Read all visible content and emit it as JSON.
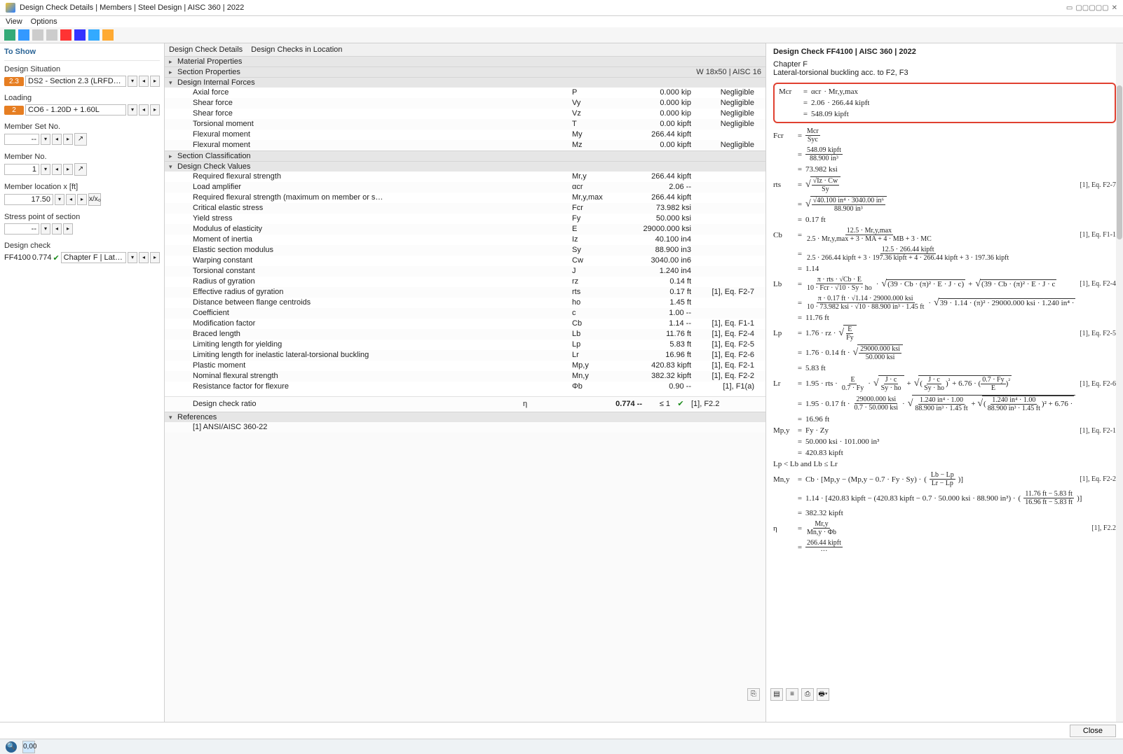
{
  "window": {
    "title": "Design Check Details | Members | Steel Design | AISC 360 | 2022",
    "menu": {
      "view": "View",
      "options": "Options"
    },
    "close": "Close"
  },
  "left": {
    "title": "To Show",
    "design_situation": {
      "label": "Design Situation",
      "badge": "2.3",
      "value": "DS2 - Section 2.3 (LRFD), 1. to 5."
    },
    "loading": {
      "label": "Loading",
      "badge": "2",
      "value": "CO6 - 1.20D + 1.60L"
    },
    "member_set": {
      "label": "Member Set No.",
      "value": "-- "
    },
    "member_no": {
      "label": "Member No.",
      "value": "1 "
    },
    "member_loc": {
      "label": "Member location x [ft]",
      "value": "17.50"
    },
    "stress_point": {
      "label": "Stress point of section",
      "value": "-- "
    },
    "design_check": {
      "label": "Design check",
      "code": "FF4100",
      "ratio": "0.774",
      "desc": "Chapter F | Lateral-torsio..."
    }
  },
  "center": {
    "tab1": "Design Check Details",
    "tab2": "Design Checks in Location",
    "sections": {
      "mat": "Material Properties",
      "sect": "Section Properties",
      "sect_extra": "W 18x50 | AISC 16",
      "forces": "Design Internal Forces",
      "classif": "Section Classification",
      "values": "Design Check Values",
      "refs": "References"
    },
    "forces": [
      {
        "name": "Axial force",
        "sym": "P",
        "val": "0.000 kip",
        "ref": "Negligible"
      },
      {
        "name": "Shear force",
        "sym": "Vy",
        "val": "0.000 kip",
        "ref": "Negligible"
      },
      {
        "name": "Shear force",
        "sym": "Vz",
        "val": "0.000 kip",
        "ref": "Negligible"
      },
      {
        "name": "Torsional moment",
        "sym": "T",
        "val": "0.00 kipft",
        "ref": "Negligible"
      },
      {
        "name": "Flexural moment",
        "sym": "My",
        "val": "266.44 kipft",
        "ref": ""
      },
      {
        "name": "Flexural moment",
        "sym": "Mz",
        "val": "0.00 kipft",
        "ref": "Negligible"
      }
    ],
    "values": [
      {
        "name": "Required flexural strength",
        "sym": "Mr,y",
        "val": "266.44 kipft",
        "ref": ""
      },
      {
        "name": "Load amplifier",
        "sym": "αcr",
        "val": "2.06 --",
        "ref": ""
      },
      {
        "name": "Required flexural strength (maximum on member or s…",
        "sym": "Mr,y,max",
        "val": "266.44 kipft",
        "ref": ""
      },
      {
        "name": "Critical elastic stress",
        "sym": "Fcr",
        "val": "73.982 ksi",
        "ref": ""
      },
      {
        "name": "Yield stress",
        "sym": "Fy",
        "val": "50.000 ksi",
        "ref": ""
      },
      {
        "name": "Modulus of elasticity",
        "sym": "E",
        "val": "29000.000 ksi",
        "ref": ""
      },
      {
        "name": "Moment of inertia",
        "sym": "Iz",
        "val": "40.100 in4",
        "ref": ""
      },
      {
        "name": "Elastic section modulus",
        "sym": "Sy",
        "val": "88.900 in3",
        "ref": ""
      },
      {
        "name": "Warping constant",
        "sym": "Cw",
        "val": "3040.00 in6",
        "ref": ""
      },
      {
        "name": "Torsional constant",
        "sym": "J",
        "val": "1.240 in4",
        "ref": ""
      },
      {
        "name": "Radius of gyration",
        "sym": "rz",
        "val": "0.14 ft",
        "ref": ""
      },
      {
        "name": "Effective radius of gyration",
        "sym": "rts",
        "val": "0.17 ft",
        "ref": "[1], Eq. F2-7"
      },
      {
        "name": "Distance between flange centroids",
        "sym": "ho",
        "val": "1.45 ft",
        "ref": ""
      },
      {
        "name": "Coefficient",
        "sym": "c",
        "val": "1.00 --",
        "ref": ""
      },
      {
        "name": "Modification factor",
        "sym": "Cb",
        "val": "1.14 --",
        "ref": "[1], Eq. F1-1"
      },
      {
        "name": "Braced length",
        "sym": "Lb",
        "val": "11.76 ft",
        "ref": "[1], Eq. F2-4"
      },
      {
        "name": "Limiting length for yielding",
        "sym": "Lp",
        "val": "5.83 ft",
        "ref": "[1], Eq. F2-5"
      },
      {
        "name": "Limiting length for inelastic lateral-torsional buckling",
        "sym": "Lr",
        "val": "16.96 ft",
        "ref": "[1], Eq. F2-6"
      },
      {
        "name": "Plastic moment",
        "sym": "Mp,y",
        "val": "420.83 kipft",
        "ref": "[1], Eq. F2-1"
      },
      {
        "name": "Nominal flexural strength",
        "sym": "Mn,y",
        "val": "382.32 kipft",
        "ref": "[1], Eq. F2-2"
      },
      {
        "name": "Resistance factor for flexure",
        "sym": "Φb",
        "val": "0.90 --",
        "ref": "[1], F1(a)"
      }
    ],
    "ratio": {
      "name": "Design check ratio",
      "sym": "η",
      "val": "0.774 --",
      "limit": "≤ 1",
      "ref": "[1], F2.2"
    },
    "ref1": "[1] ANSI/AISC 360-22"
  },
  "right": {
    "title": "Design Check FF4100 | AISC 360 | 2022",
    "sub1": "Chapter F",
    "sub2": "Lateral-torsional buckling acc. to F2, F3",
    "mcr": {
      "var": "Mcr",
      "l1a": "αcr",
      "l1b": "· Mr,y,max",
      "l2a": "2.06",
      "l2b": "· 266.44 kipft",
      "l3": "548.09 kipft"
    },
    "fcr": {
      "var": "Fcr",
      "num1": "Mcr",
      "den1": "Syc",
      "num2": "548.09 kipft",
      "den2": "88.900 in³",
      "res": "73.982 ksi"
    },
    "rts": {
      "var": "rts",
      "ref": "[1], Eq. F2-7",
      "inner_num": "Iz · Cw",
      "den1": "Sy",
      "num2": "40.100 in⁴ · 3040.00 in⁶",
      "den2": "88.900 in³",
      "res": "0.17 ft"
    },
    "cb": {
      "var": "Cb",
      "ref": "[1], Eq. F1-1",
      "num1": "12.5 · Mr,y,max",
      "den1": "2.5 · Mr,y,max + 3 · MA + 4 · MB + 3 · MC",
      "num2": "12.5 · 266.44 kipft",
      "den2": "2.5 · 266.44 kipft + 3 · 197.36 kipft + 4 · 266.44 kipft + 3 · 197.36 kipft",
      "res": "1.14"
    },
    "lb": {
      "var": "Lb",
      "ref": "[1], Eq. F2-4",
      "f_num": "π · rts · √Cb · E",
      "f_den": "10 · Fcr · √10 · Sy · ho",
      "sq1": "(39 · Cb · (π)² · E · J · c)",
      "sq2": "(39 · Cb · (π)² · E · J · c",
      "g_num": "π · 0.17 ft · √1.14 · 29000.000 ksi",
      "g_den": "10 · 73.982 ksi · √10 · 88.900 in³ · 1.45 ft",
      "g_sq": "39 · 1.14 · (π)² · 29000.000 ksi · 1.240 in⁴ ·",
      "res": "11.76 ft"
    },
    "lp": {
      "var": "Lp",
      "ref": "[1], Eq. F2-5",
      "body1": "1.76 · rz · ",
      "sq_num": "E",
      "sq_den": "Fy",
      "body2": "1.76 · 0.14 ft · ",
      "sq2_num": "29000.000 ksi",
      "sq2_den": "50.000 ksi",
      "res": "5.83 ft"
    },
    "lr": {
      "var": "Lr",
      "ref": "[1], Eq. F2-6",
      "pre": "1.95 · rts · ",
      "f1_num": "E",
      "f1_den": "0.7 · Fy",
      "sq1_num": "J · c",
      "sq1_den": "Sy · ho",
      "mid1": " + ",
      "pow1": "²",
      "f2_num": "J · c",
      "f2_den": "Sy · ho",
      "plus676": " + 6.76 · ",
      "f3_num": "0.7 · Fy",
      "f3_den": "E",
      "pre2": "1.95 · 0.17 ft · ",
      "g1_num": "29000.000 ksi",
      "g1_den": "0.7 · 50.000 ksi",
      "g2_num": "1.240 in⁴ · 1.00",
      "g2_den": "88.900 in³ · 1.45 ft",
      "g3_num": "1.240 in⁴ · 1.00",
      "g3_den": "88.900 in³ · 1.45 ft",
      "tail": " + 6.76 ·",
      "res": "16.96 ft"
    },
    "mpy": {
      "var": "Mp,y",
      "ref": "[1], Eq. F2-1",
      "body1": "Fy · Zy",
      "body2": "50.000 ksi · 101.000 in³",
      "res": "420.83 kipft"
    },
    "cond": "Lp < Lb and Lb ≤ Lr",
    "mny": {
      "var": "Mn,y",
      "ref": "[1], Eq. F2-2",
      "body1": "Cb · [Mp,y − (Mp,y − 0.7 · Fy · Sy) · ",
      "f1_num": "Lb − Lp",
      "f1_den": "Lr − Lp",
      "body2": "1.14 · [420.83 kipft − (420.83 kipft − 0.7 · 50.000 ksi · 88.900 in³) · ",
      "f2_num": "11.76 ft − 5.83 ft",
      "f2_den": "16.96 ft − 5.83 ft",
      "res": "382.32 kipft"
    },
    "eta": {
      "var": "η",
      "ref": "[1], F2.2",
      "num": "Mr,y",
      "den": "Mn,y · Φb",
      "num2": "266.44 kipft"
    }
  }
}
